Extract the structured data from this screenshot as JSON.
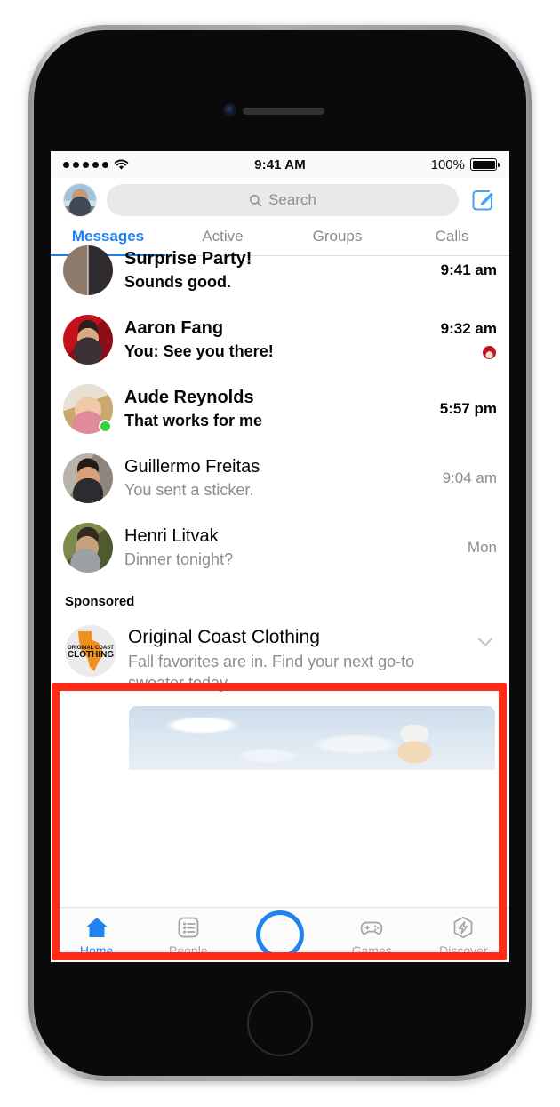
{
  "status_bar": {
    "signal_dots": 5,
    "wifi_icon": "wifi-icon",
    "time": "9:41 AM",
    "battery_percent": "100%",
    "battery_level": 100
  },
  "header": {
    "avatar_name": "my-profile-avatar",
    "search": {
      "placeholder": "Search",
      "value": "",
      "icon": "search-icon"
    },
    "compose_icon": "compose-icon"
  },
  "tabs": {
    "items": [
      {
        "label": "Messages",
        "active": true
      },
      {
        "label": "Active",
        "active": false
      },
      {
        "label": "Groups",
        "active": false
      },
      {
        "label": "Calls",
        "active": false
      }
    ]
  },
  "threads": [
    {
      "name": "Surprise Party!",
      "preview": "Sounds good.",
      "time": "9:41 am",
      "unread": true,
      "clipped": true,
      "presence": false,
      "seen_receipt": false,
      "avatar": "group-avatar-surprise-party"
    },
    {
      "name": "Aaron Fang",
      "preview": "You: See you there!",
      "time": "9:32 am",
      "unread": true,
      "clipped": false,
      "presence": false,
      "seen_receipt": true,
      "avatar": "avatar-aaron-fang"
    },
    {
      "name": "Aude Reynolds",
      "preview": "That works for me",
      "time": "5:57 pm",
      "unread": true,
      "clipped": false,
      "presence": true,
      "seen_receipt": false,
      "avatar": "avatar-aude-reynolds"
    },
    {
      "name": "Guillermo Freitas",
      "preview": "You sent a sticker.",
      "time": "9:04 am",
      "unread": false,
      "clipped": false,
      "presence": false,
      "seen_receipt": false,
      "avatar": "avatar-guillermo-freitas"
    },
    {
      "name": "Henri Litvak",
      "preview": "Dinner tonight?",
      "time": "Mon",
      "unread": false,
      "clipped": false,
      "presence": false,
      "seen_receipt": false,
      "avatar": "avatar-henri-litvak"
    }
  ],
  "sponsored": {
    "label": "Sponsored",
    "advertiser": "Original Coast Clothing",
    "body": "Fall favorites are in. Find your next go-to sweater today.",
    "logo_line1": "ORIGINAL COAST",
    "logo_line2": "CLOTHING",
    "chevron_icon": "chevron-down-icon",
    "creative_alt": "woman-in-winter-hat-snow-scene"
  },
  "tab_bar": {
    "items": [
      {
        "label": "Home",
        "icon": "home-icon",
        "active": true
      },
      {
        "label": "People",
        "icon": "people-list-icon",
        "active": false
      },
      {
        "label": "",
        "icon": "camera-circle-icon",
        "active": false
      },
      {
        "label": "Games",
        "icon": "gamepad-icon",
        "active": false
      },
      {
        "label": "Discover",
        "icon": "discover-bolt-icon",
        "active": false
      }
    ]
  },
  "annotation": {
    "highlight_color": "#ff2a18",
    "target": "sponsored-ad-and-tab-bar"
  },
  "colors": {
    "accent_blue": "#1f7fef",
    "text_primary": "#050505",
    "text_secondary": "#8a8d91",
    "search_bg": "#e9e9eb",
    "presence_green": "#31d13f",
    "highlight_red": "#ff2a18"
  }
}
